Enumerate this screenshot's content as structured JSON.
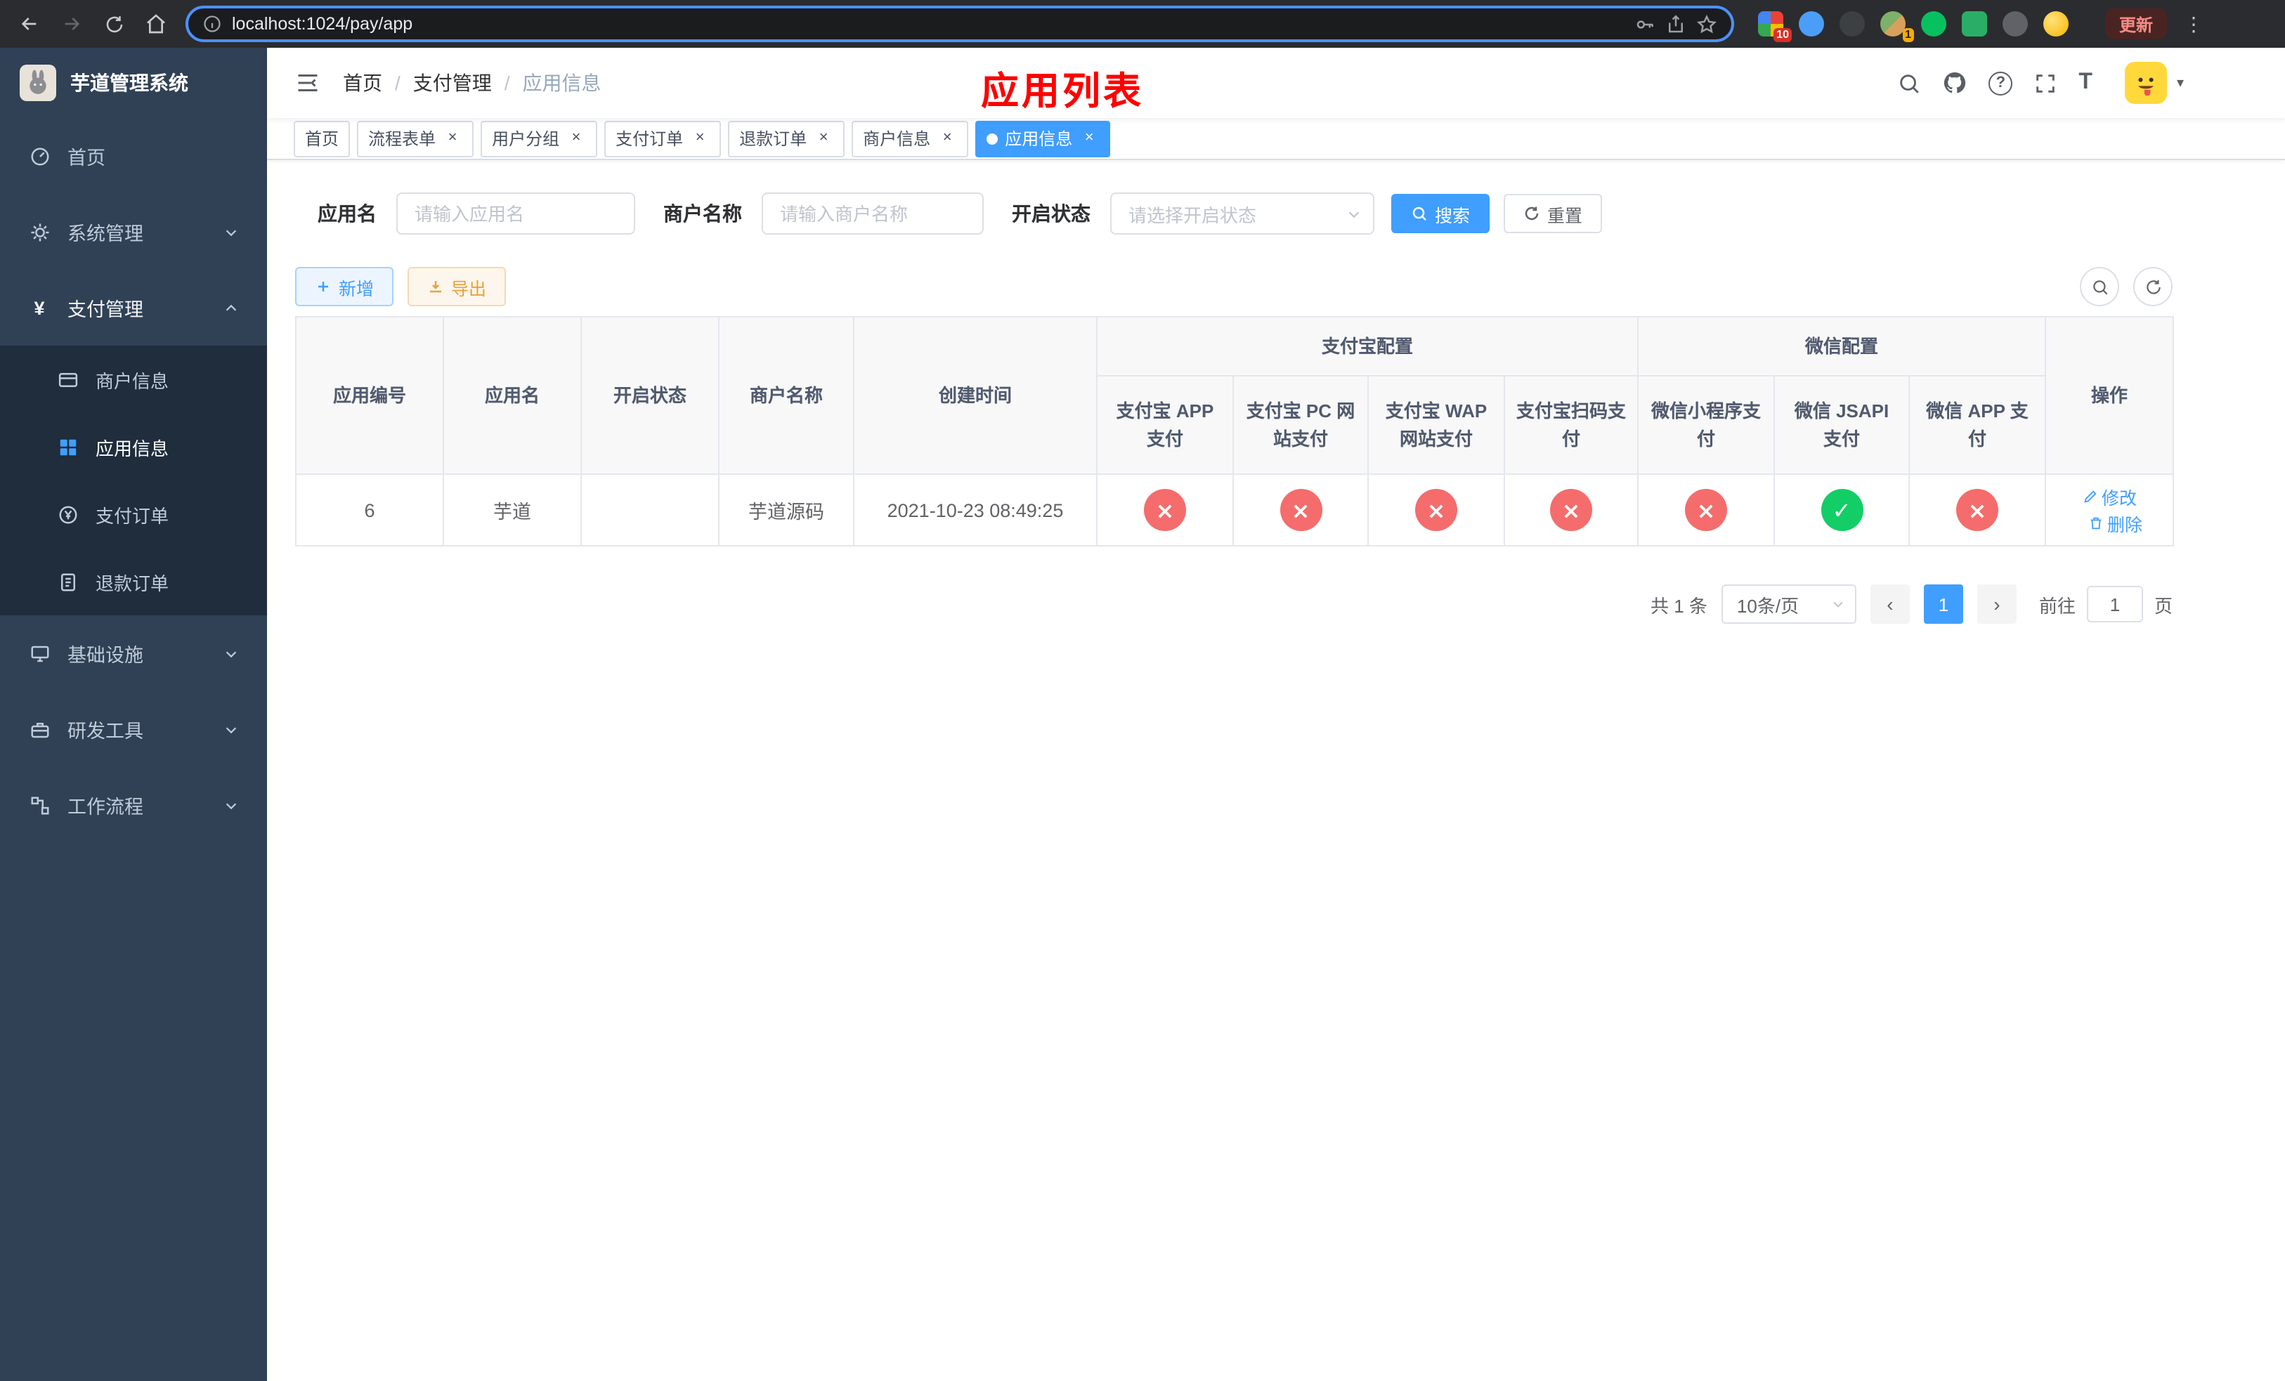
{
  "browser": {
    "url": "localhost:1024/pay/app",
    "update_label": "更新",
    "ext_badge_grid": "10",
    "ext_badge_avatar": "1"
  },
  "sidebar": {
    "app_title": "芋道管理系统",
    "menu": [
      {
        "label": "首页"
      },
      {
        "label": "系统管理"
      },
      {
        "label": "支付管理"
      },
      {
        "label": "商户信息"
      },
      {
        "label": "应用信息"
      },
      {
        "label": "支付订单"
      },
      {
        "label": "退款订单"
      },
      {
        "label": "基础设施"
      },
      {
        "label": "研发工具"
      },
      {
        "label": "工作流程"
      }
    ]
  },
  "header": {
    "breadcrumb": [
      "首页",
      "支付管理",
      "应用信息"
    ],
    "page_title": "应用列表"
  },
  "tabs": [
    {
      "label": "首页"
    },
    {
      "label": "流程表单"
    },
    {
      "label": "用户分组"
    },
    {
      "label": "支付订单"
    },
    {
      "label": "退款订单"
    },
    {
      "label": "商户信息"
    },
    {
      "label": "应用信息"
    }
  ],
  "filters": {
    "app_name_label": "应用名",
    "app_name_placeholder": "请输入应用名",
    "merchant_label": "商户名称",
    "merchant_placeholder": "请输入商户名称",
    "status_label": "开启状态",
    "status_placeholder": "请选择开启状态",
    "search_label": "搜索",
    "reset_label": "重置"
  },
  "toolbar": {
    "add_label": "新增",
    "export_label": "导出"
  },
  "table": {
    "columns": {
      "app_id": "应用编号",
      "app_name": "应用名",
      "status": "开启状态",
      "merchant": "商户名称",
      "created": "创建时间",
      "alipay_group": "支付宝配置",
      "wechat_group": "微信配置",
      "alipay_app": "支付宝 APP 支付",
      "alipay_pc": "支付宝 PC 网站支付",
      "alipay_wap": "支付宝 WAP 网站支付",
      "alipay_qr": "支付宝扫码支付",
      "wx_lite": "微信小程序支付",
      "wx_jsapi": "微信 JSAPI 支付",
      "wx_app": "微信 APP 支付",
      "actions": "操作"
    },
    "row": {
      "app_id": "6",
      "app_name": "芋道",
      "enabled": true,
      "merchant": "芋道源码",
      "created": "2021-10-23 08:49:25",
      "alipay_app": false,
      "alipay_pc": false,
      "alipay_wap": false,
      "alipay_qr": false,
      "wx_lite": false,
      "wx_jsapi": true,
      "wx_app": false,
      "edit_label": "修改",
      "delete_label": "删除"
    }
  },
  "pagination": {
    "total_label": "共 1 条",
    "page_size_label": "10条/页",
    "current_page": "1",
    "goto_label": "前往",
    "goto_value": "1",
    "unit_label": "页"
  },
  "colors": {
    "accent": "#409eff",
    "success": "#13ce66",
    "danger": "#f56c6c",
    "page_title_red": "#ff0000",
    "sidebar_bg": "#304156",
    "submenu_bg": "#1f2d3d"
  }
}
